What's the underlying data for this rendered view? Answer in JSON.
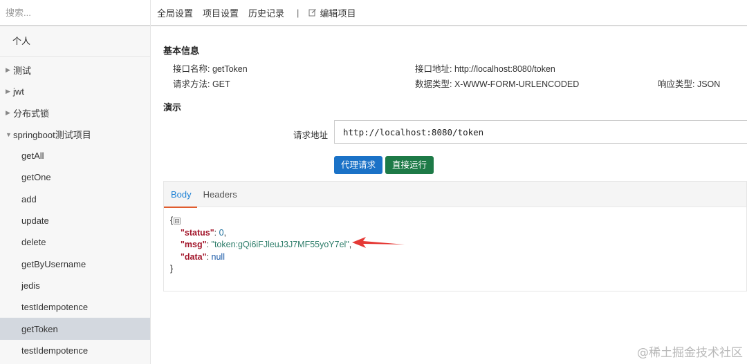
{
  "sidebar": {
    "search_placeholder": "搜索...",
    "group_title": "个人",
    "folders": [
      {
        "label": "测试",
        "expanded": false
      },
      {
        "label": "jwt",
        "expanded": false
      },
      {
        "label": "分布式锁",
        "expanded": false
      },
      {
        "label": "springboot测试项目",
        "expanded": true
      }
    ],
    "items": [
      {
        "label": "getAll"
      },
      {
        "label": "getOne"
      },
      {
        "label": "add"
      },
      {
        "label": "update"
      },
      {
        "label": "delete"
      },
      {
        "label": "getByUsername"
      },
      {
        "label": "jedis"
      },
      {
        "label": "testIdempotence"
      },
      {
        "label": "getToken",
        "active": true
      },
      {
        "label": "testIdempotence"
      }
    ]
  },
  "topbar": {
    "global_settings": "全局设置",
    "project_settings": "项目设置",
    "history": "历史记录",
    "separator": "|",
    "edit_project": "编辑项目"
  },
  "basic_info": {
    "title": "基本信息",
    "api_name": "接口名称: getToken",
    "api_url": "接口地址: http://localhost:8080/token",
    "method": "请求方法: GET",
    "data_type": "数据类型: X-WWW-FORM-URLENCODED",
    "response_type": "响应类型: JSON"
  },
  "demo": {
    "title": "演示",
    "url_label": "请求地址",
    "url_value": "http://localhost:8080/token",
    "proxy_button": "代理请求",
    "direct_button": "直接运行"
  },
  "response": {
    "tabs": [
      "Body",
      "Headers"
    ],
    "active_tab": "Body",
    "open_brace": "{",
    "close_brace": "}",
    "collapse_symbol": "⊟",
    "lines": [
      {
        "key": "\"status\"",
        "value": "0",
        "kind": "num",
        "trail": ","
      },
      {
        "key": "\"msg\"",
        "value": "\"token:gQi6iFJleuJ3J7MF55yoY7el\"",
        "kind": "str",
        "trail": ","
      },
      {
        "key": "\"data\"",
        "value": "null",
        "kind": "nul",
        "trail": ""
      }
    ]
  },
  "watermark": "@稀土掘金技术社区",
  "colors": {
    "primary_button": "#1a72c7",
    "success_button": "#1d7a47",
    "active_tab": "#1a7fd4",
    "annotation_arrow": "#e53935"
  }
}
